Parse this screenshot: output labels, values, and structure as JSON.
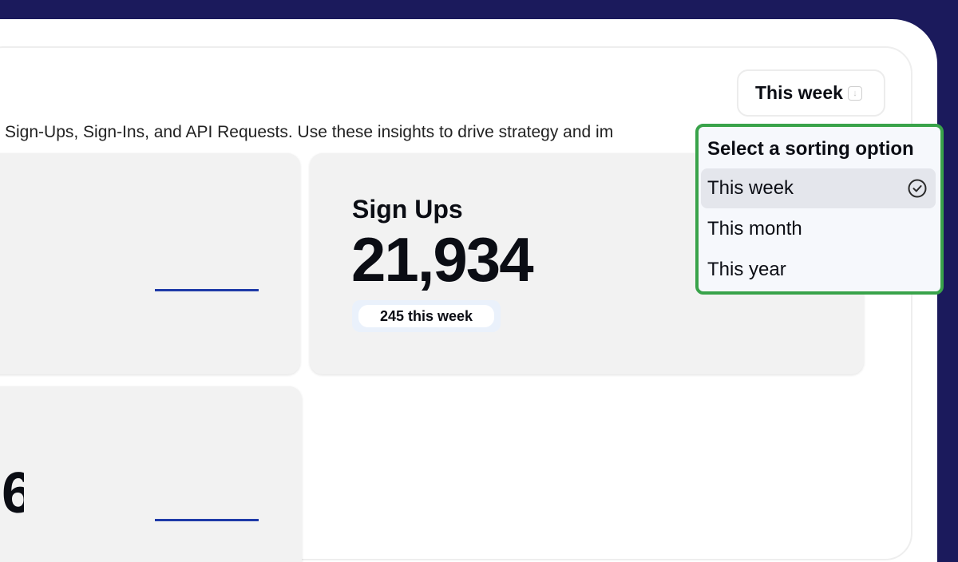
{
  "header": {
    "period_button_label": "This week"
  },
  "description": "Sign-Ups, Sign-Ins, and API Requests. Use these insights to drive strategy and im",
  "cards": {
    "left_bottom_value_fragment": "6",
    "signups": {
      "title": "Sign Ups",
      "value": "21,934",
      "delta": "245 this week"
    }
  },
  "dropdown": {
    "title": "Select a sorting option",
    "options": [
      {
        "label": "This week",
        "selected": true
      },
      {
        "label": "This month",
        "selected": false
      },
      {
        "label": "This year",
        "selected": false
      }
    ]
  },
  "colors": {
    "frame": "#1b1a5c",
    "accent_link": "#1e3aa8",
    "highlight_border": "#39a34a"
  },
  "icons": {
    "period_chevron": "chevron-down-icon",
    "selected_check": "check-circle-icon"
  }
}
